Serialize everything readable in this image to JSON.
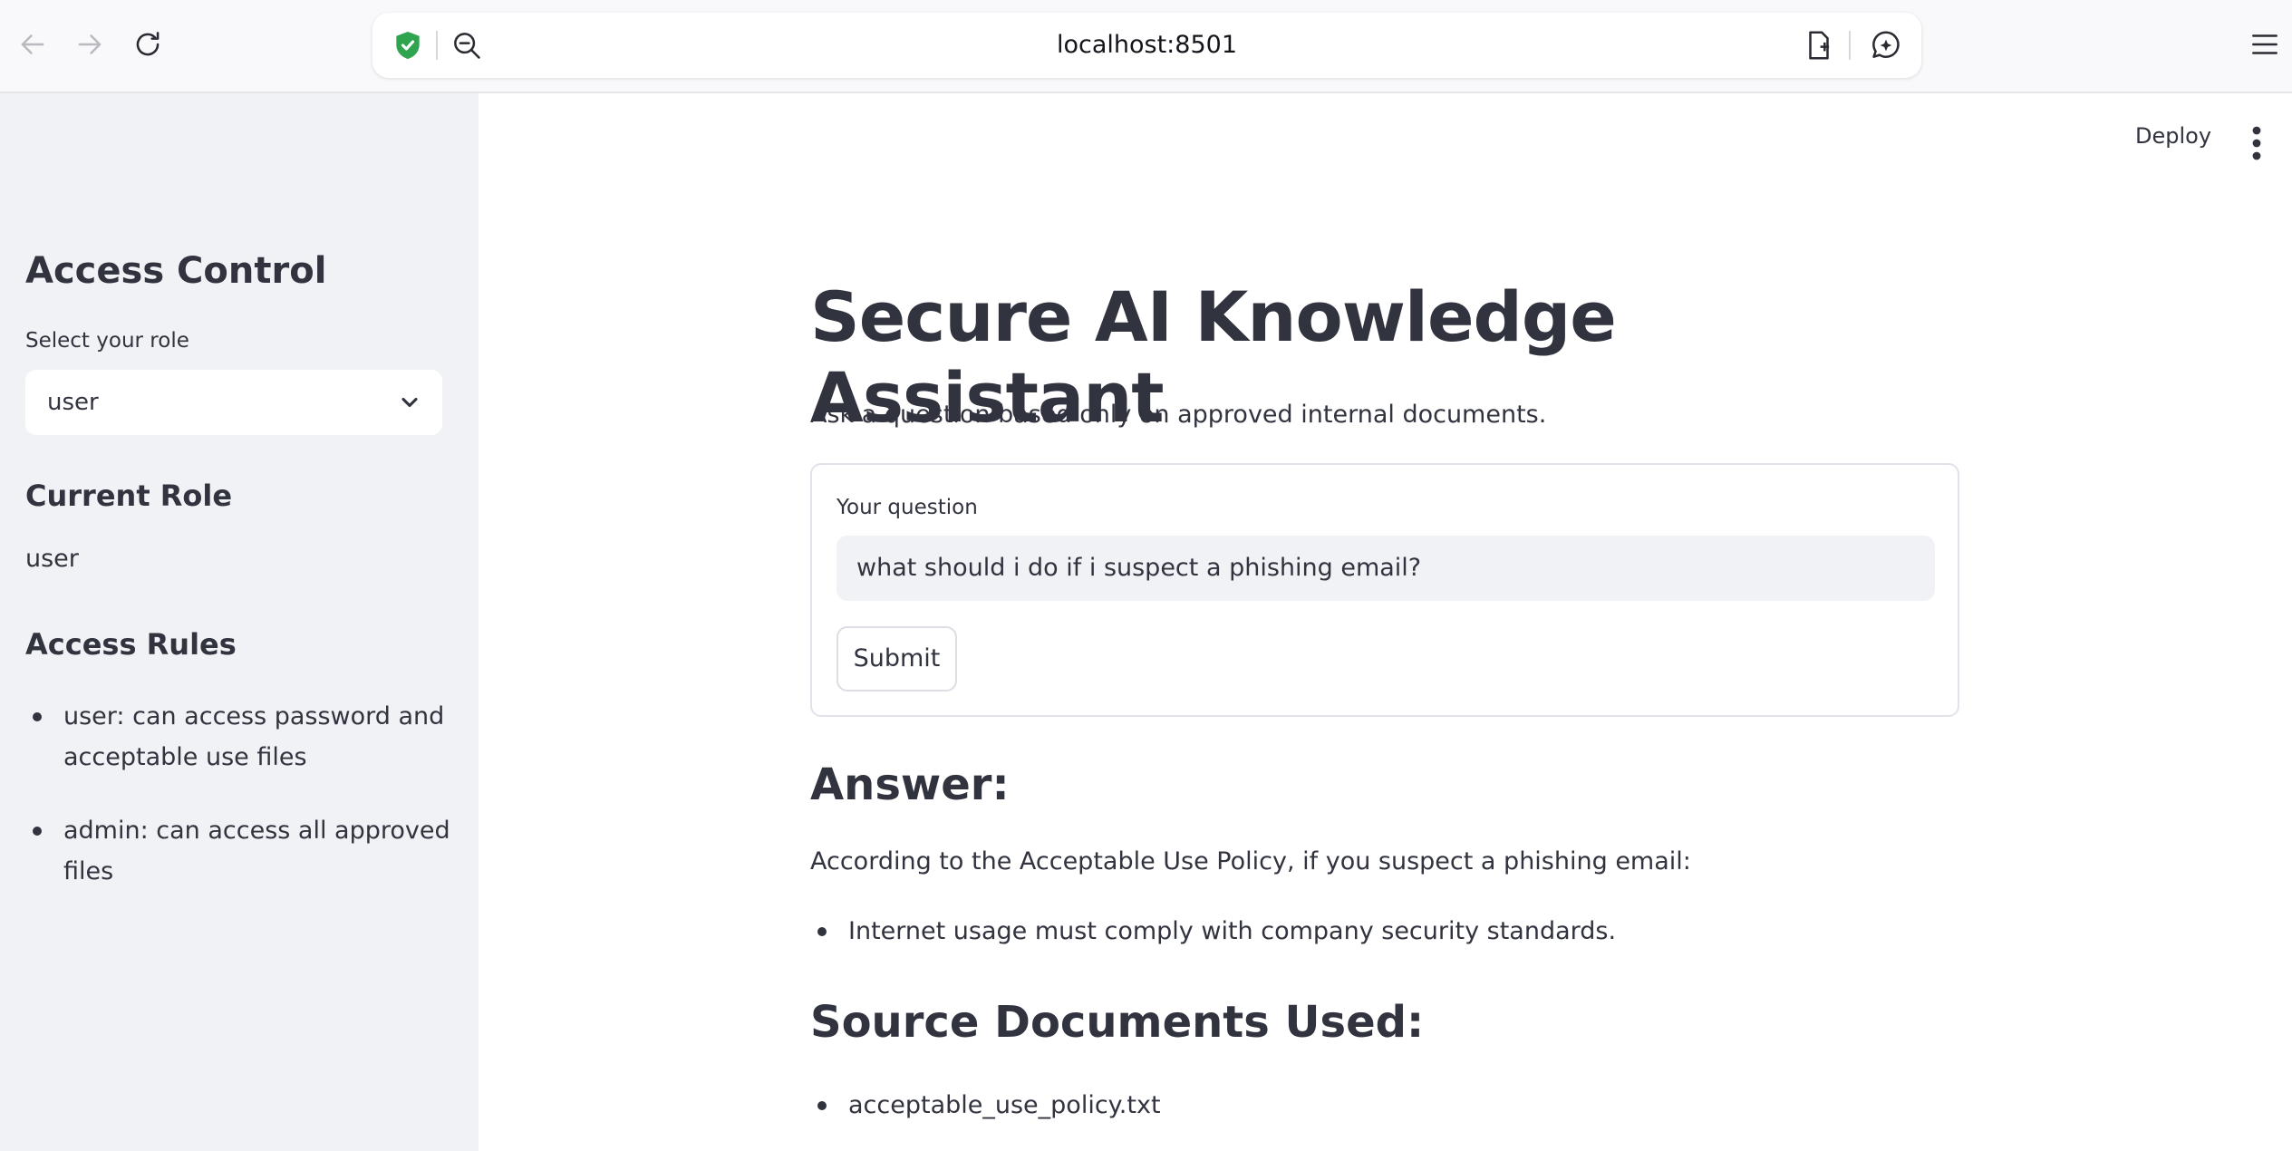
{
  "browser": {
    "url": "localhost:8501"
  },
  "sidebar": {
    "heading": "Access Control",
    "role_select_label": "Select your role",
    "role_select_value": "user",
    "current_role_heading": "Current Role",
    "current_role_value": "user",
    "access_rules_heading": "Access Rules",
    "rules": [
      "user: can access password and acceptable use files",
      "admin: can access all approved files"
    ]
  },
  "header": {
    "deploy_label": "Deploy"
  },
  "main": {
    "title": "Secure AI Knowledge Assistant",
    "subtitle": "Ask a question based only on approved internal documents.",
    "form": {
      "question_label": "Your question",
      "question_value": "what should i do if i suspect a phishing email?",
      "submit_label": "Submit"
    },
    "answer_heading": "Answer:",
    "answer_intro": "According to the Acceptable Use Policy, if you suspect a phishing email:",
    "answer_points": [
      "Internet usage must comply with company security standards."
    ],
    "sources_heading": "Source Documents Used:",
    "sources": [
      "acceptable_use_policy.txt"
    ]
  },
  "colors": {
    "sidebar_bg": "#f0f2f6",
    "text": "#31333f",
    "shield_green": "#2ea44f"
  }
}
